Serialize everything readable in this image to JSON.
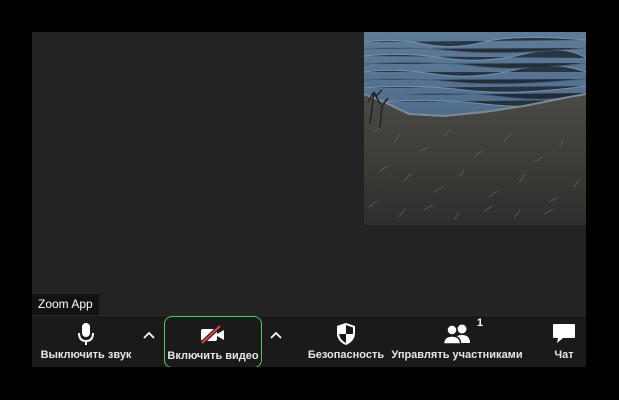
{
  "participant": {
    "name": "Zoom App"
  },
  "toolbar": {
    "mute_label": "Выключить звук",
    "video_label": "Включить видео",
    "security_label": "Безопасность",
    "participants_label": "Управлять участниками",
    "participants_count": "1",
    "chat_label": "Чат"
  },
  "colors": {
    "accent_border": "#3fcf52",
    "video_off_slash": "#e0424a",
    "toolbar_bg": "#1a1a1a"
  },
  "icons": [
    "microphone-icon",
    "chevron-up-icon",
    "video-camera-off-icon",
    "shield-icon",
    "participants-icon",
    "chat-bubble-icon"
  ]
}
